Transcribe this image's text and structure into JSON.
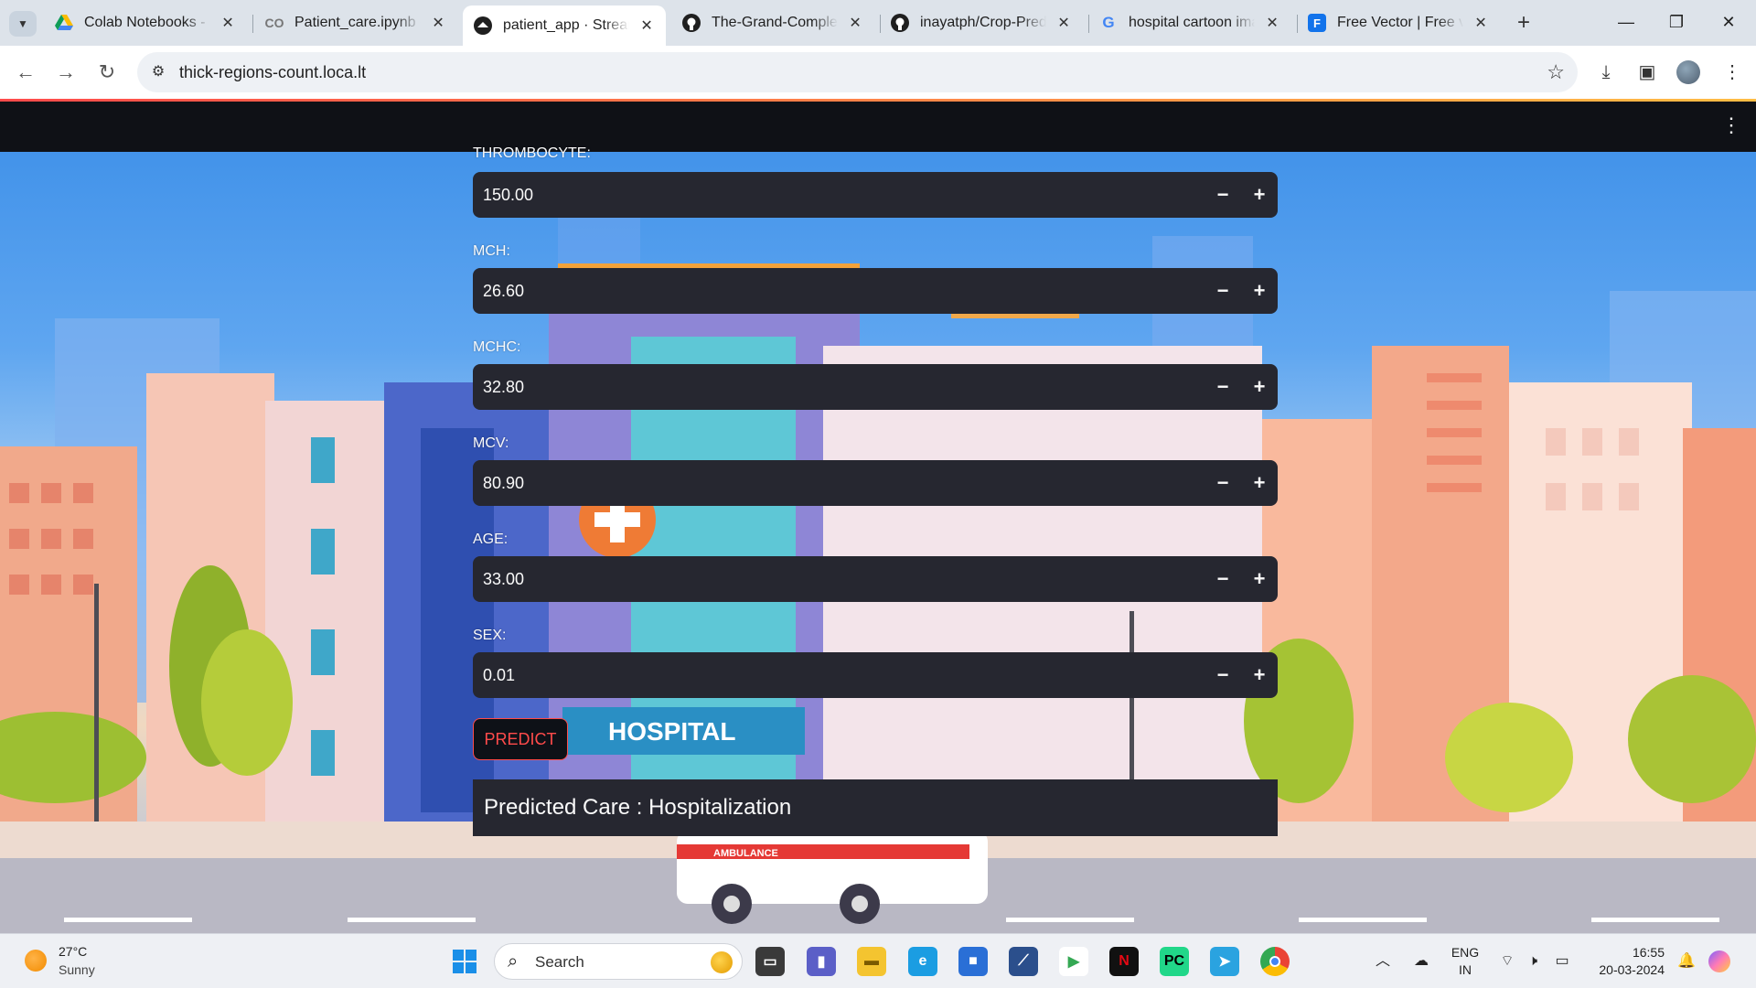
{
  "browser": {
    "tabs": [
      {
        "title": "Colab Notebooks - Google Drive",
        "favicon": "google-drive-icon",
        "active": false
      },
      {
        "title": "Patient_care.ipynb - Colab",
        "favicon": "colab-icon",
        "active": false
      },
      {
        "title": "patient_app · Streamlit",
        "favicon": "streamlit-icon",
        "active": true
      },
      {
        "title": "The-Grand-Complete-Data-Science",
        "favicon": "github-icon",
        "active": false
      },
      {
        "title": "inayatph/Crop-Prediction",
        "favicon": "github-icon",
        "active": false
      },
      {
        "title": "hospital cartoon images",
        "favicon": "google-icon",
        "active": false
      },
      {
        "title": "Free Vector | Free vector",
        "favicon": "freepik-icon",
        "active": false
      }
    ],
    "url": "thick-regions-count.loca.lt"
  },
  "form": {
    "fields": [
      {
        "label": "THROMBOCYTE:",
        "value": "150.00"
      },
      {
        "label": "MCH:",
        "value": "26.60"
      },
      {
        "label": "MCHC:",
        "value": "32.80"
      },
      {
        "label": "MCV:",
        "value": "80.90"
      },
      {
        "label": "AGE:",
        "value": "33.00"
      },
      {
        "label": "SEX:",
        "value": "0.01"
      }
    ],
    "decrement_symbol": "−",
    "increment_symbol": "+",
    "predict_label": "PREDICT",
    "result_text": "Predicted Care : Hospitalization",
    "background_sign": "HOSPITAL",
    "ambulance_text": "AMBULANCE"
  },
  "taskbar": {
    "weather_temp": "27°C",
    "weather_condition": "Sunny",
    "search_placeholder": "Search",
    "language": "ENG",
    "region": "IN",
    "time": "16:55",
    "date": "20-03-2024"
  },
  "colors": {
    "streamlit_accent": "#ff4b4b",
    "input_bg": "#262730",
    "header_bg": "#0f1116"
  }
}
